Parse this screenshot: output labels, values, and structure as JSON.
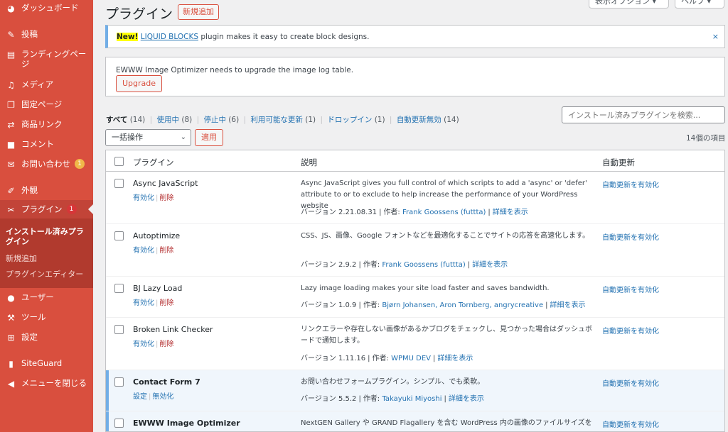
{
  "sidebar": {
    "items": [
      {
        "label": "ダッシュボード",
        "icon": "dashboard-icon"
      },
      {
        "label": "投稿",
        "icon": "pin-icon"
      },
      {
        "label": "ランディングページ",
        "icon": "page-icon"
      },
      {
        "label": "メディア",
        "icon": "media-icon"
      },
      {
        "label": "固定ページ",
        "icon": "pages-icon"
      },
      {
        "label": "商品リンク",
        "icon": "link-icon"
      },
      {
        "label": "コメント",
        "icon": "comment-icon"
      },
      {
        "label": "お問い合わせ",
        "icon": "mail-icon",
        "badge": "1"
      },
      {
        "label": "外観",
        "icon": "appearance-icon"
      },
      {
        "label": "プラグイン",
        "icon": "plugin-icon",
        "badge": "1"
      },
      {
        "label": "ユーザー",
        "icon": "user-icon"
      },
      {
        "label": "ツール",
        "icon": "wrench-icon"
      },
      {
        "label": "設定",
        "icon": "settings-icon"
      },
      {
        "label": "SiteGuard",
        "icon": "siteguard-icon"
      },
      {
        "label": "メニューを閉じる",
        "icon": "collapse-icon"
      }
    ],
    "submenu": [
      "インストール済みプラグイン",
      "新規追加",
      "プラグインエディター"
    ]
  },
  "header": {
    "title": "プラグイン",
    "add_new": "新規追加",
    "screen_options": "表示オプション ▾",
    "help": "ヘルプ ▾"
  },
  "notices": {
    "liquid": {
      "new": "New!",
      "link": "LIQUID BLOCKS",
      "text": " plugin makes it easy to create block designs.",
      "close": "×"
    },
    "ewww": {
      "text": "EWWW Image Optimizer needs to upgrade the image log table.",
      "button": "Upgrade"
    }
  },
  "filters": {
    "all": "すべて",
    "all_count": "(14)",
    "active": "使用中",
    "active_count": "(8)",
    "inactive": "停止中",
    "inactive_count": "(6)",
    "update": "利用可能な更新",
    "update_count": "(1)",
    "dropins": "ドロップイン",
    "dropins_count": "(1)",
    "autoupdate_off": "自動更新無効",
    "autoupdate_off_count": "(14)"
  },
  "search": {
    "placeholder": "インストール済みプラグインを検索..."
  },
  "bulk": {
    "selected": "一括操作",
    "apply": "適用",
    "items_count": "14個の項目"
  },
  "table": {
    "columns": {
      "plugin": "プラグイン",
      "description": "説明",
      "auto_update": "自動更新"
    },
    "rows": [
      {
        "name": "Async JavaScript",
        "action1": "有効化",
        "action2": "削除",
        "desc": "Async JavaScript gives you full control of which scripts to add a 'async' or 'defer' attribute to or to exclude to help increase the performance of your WordPress website",
        "version": "バージョン 2.21.08.31",
        "author_label": "作者:",
        "author": "Frank Goossens (futtta)",
        "details": "詳細を表示",
        "auto": "自動更新を有効化"
      },
      {
        "name": "Autoptimize",
        "action1": "有効化",
        "action2": "削除",
        "desc": "CSS、JS、画像、Google フォントなどを最適化することでサイトの応答を高速化します。",
        "version": "バージョン 2.9.2",
        "author_label": "作者:",
        "author": "Frank Goossens (futtta)",
        "details": "詳細を表示",
        "auto": "自動更新を有効化"
      },
      {
        "name": "BJ Lazy Load",
        "action1": "有効化",
        "action2": "削除",
        "desc": "Lazy image loading makes your site load faster and saves bandwidth.",
        "version": "バージョン 1.0.9",
        "author_label": "作者:",
        "author": "Bjørn Johansen, Aron Tornberg, angrycreative",
        "details": "詳細を表示",
        "auto": "自動更新を有効化"
      },
      {
        "name": "Broken Link Checker",
        "action1": "有効化",
        "action2": "削除",
        "desc": "リンクエラーや存在しない画像があるかブログをチェックし、見つかった場合はダッシュボードで通知します。",
        "version": "バージョン 1.11.16",
        "author_label": "作者:",
        "author": "WPMU DEV",
        "details": "詳細を表示",
        "auto": "自動更新を有効化"
      },
      {
        "name": "Contact Form 7",
        "action1": "設定",
        "action2": "無効化",
        "desc": "お問い合わせフォームプラグイン。シンプル、でも柔軟。",
        "version": "バージョン 5.5.2",
        "author_label": "作者:",
        "author": "Takayuki Miyoshi",
        "details": "詳細を表示",
        "auto": "自動更新を有効化"
      },
      {
        "name": "EWWW Image Optimizer",
        "desc": "NextGEN Gallery や GRAND Flagallery を含む WordPress 内の画像のファイルサイズを",
        "auto": "自動更新を有効化"
      }
    ]
  }
}
